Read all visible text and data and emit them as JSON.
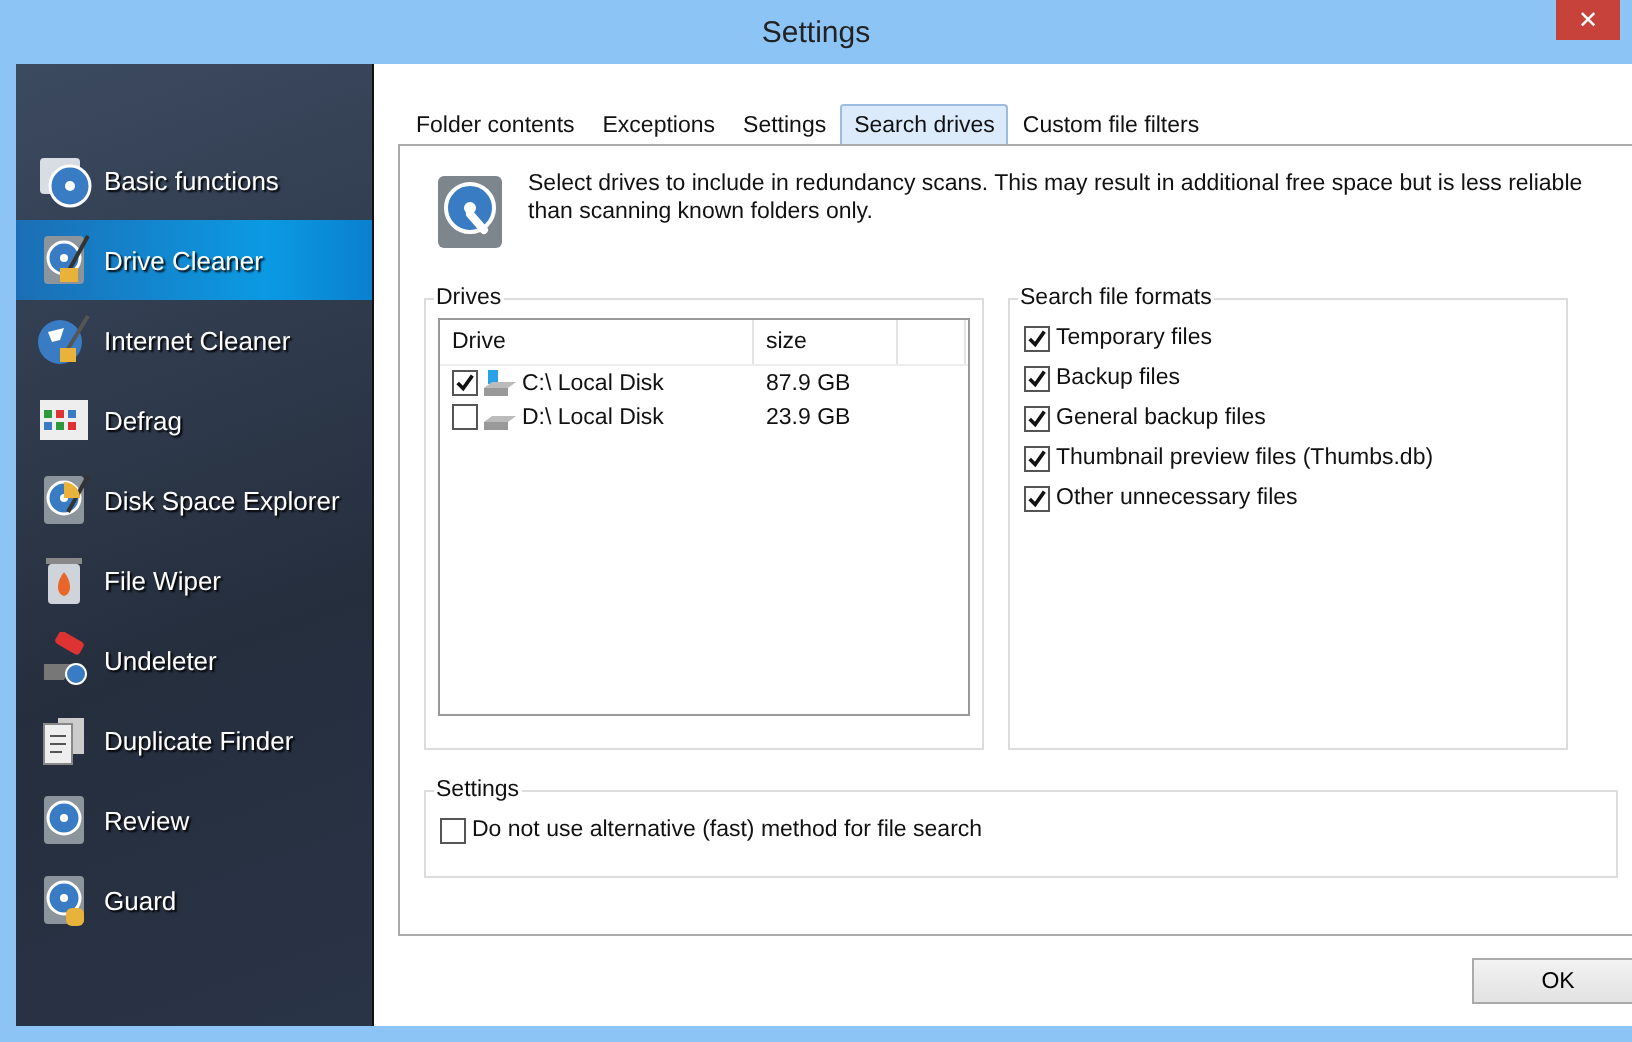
{
  "window": {
    "title": "Settings",
    "close": "✕"
  },
  "sidebar": {
    "items": [
      {
        "label": "Basic functions",
        "selected": false
      },
      {
        "label": "Drive Cleaner",
        "selected": true
      },
      {
        "label": "Internet Cleaner",
        "selected": false
      },
      {
        "label": "Defrag",
        "selected": false
      },
      {
        "label": "Disk Space Explorer",
        "selected": false
      },
      {
        "label": "File Wiper",
        "selected": false
      },
      {
        "label": "Undeleter",
        "selected": false
      },
      {
        "label": "Duplicate Finder",
        "selected": false
      },
      {
        "label": "Review",
        "selected": false
      },
      {
        "label": "Guard",
        "selected": false
      }
    ]
  },
  "tabs": [
    {
      "label": "Folder contents",
      "selected": false
    },
    {
      "label": "Exceptions",
      "selected": false
    },
    {
      "label": "Settings",
      "selected": false
    },
    {
      "label": "Search drives",
      "selected": true
    },
    {
      "label": "Custom file filters",
      "selected": false
    }
  ],
  "description": "Select drives to include in redundancy scans. This may result in additional free space but is less reliable than scanning known folders only.",
  "drives": {
    "title": "Drives",
    "columns": [
      "Drive",
      "size"
    ],
    "rows": [
      {
        "drive": "C:\\ Local Disk",
        "size": "87.9 GB",
        "checked": true,
        "system": true
      },
      {
        "drive": "D:\\ Local Disk",
        "size": "23.9 GB",
        "checked": false,
        "system": false
      }
    ]
  },
  "file_formats": {
    "title": "Search file formats",
    "items": [
      {
        "label": "Temporary files",
        "checked": true
      },
      {
        "label": "Backup files",
        "checked": true
      },
      {
        "label": "General backup files",
        "checked": true
      },
      {
        "label": "Thumbnail preview files (Thumbs.db)",
        "checked": true
      },
      {
        "label": "Other unnecessary files",
        "checked": true
      }
    ]
  },
  "settings": {
    "title": "Settings",
    "items": [
      {
        "label": "Do not use alternative (fast) method for file search",
        "checked": false
      }
    ]
  },
  "buttons": [
    "OK"
  ]
}
